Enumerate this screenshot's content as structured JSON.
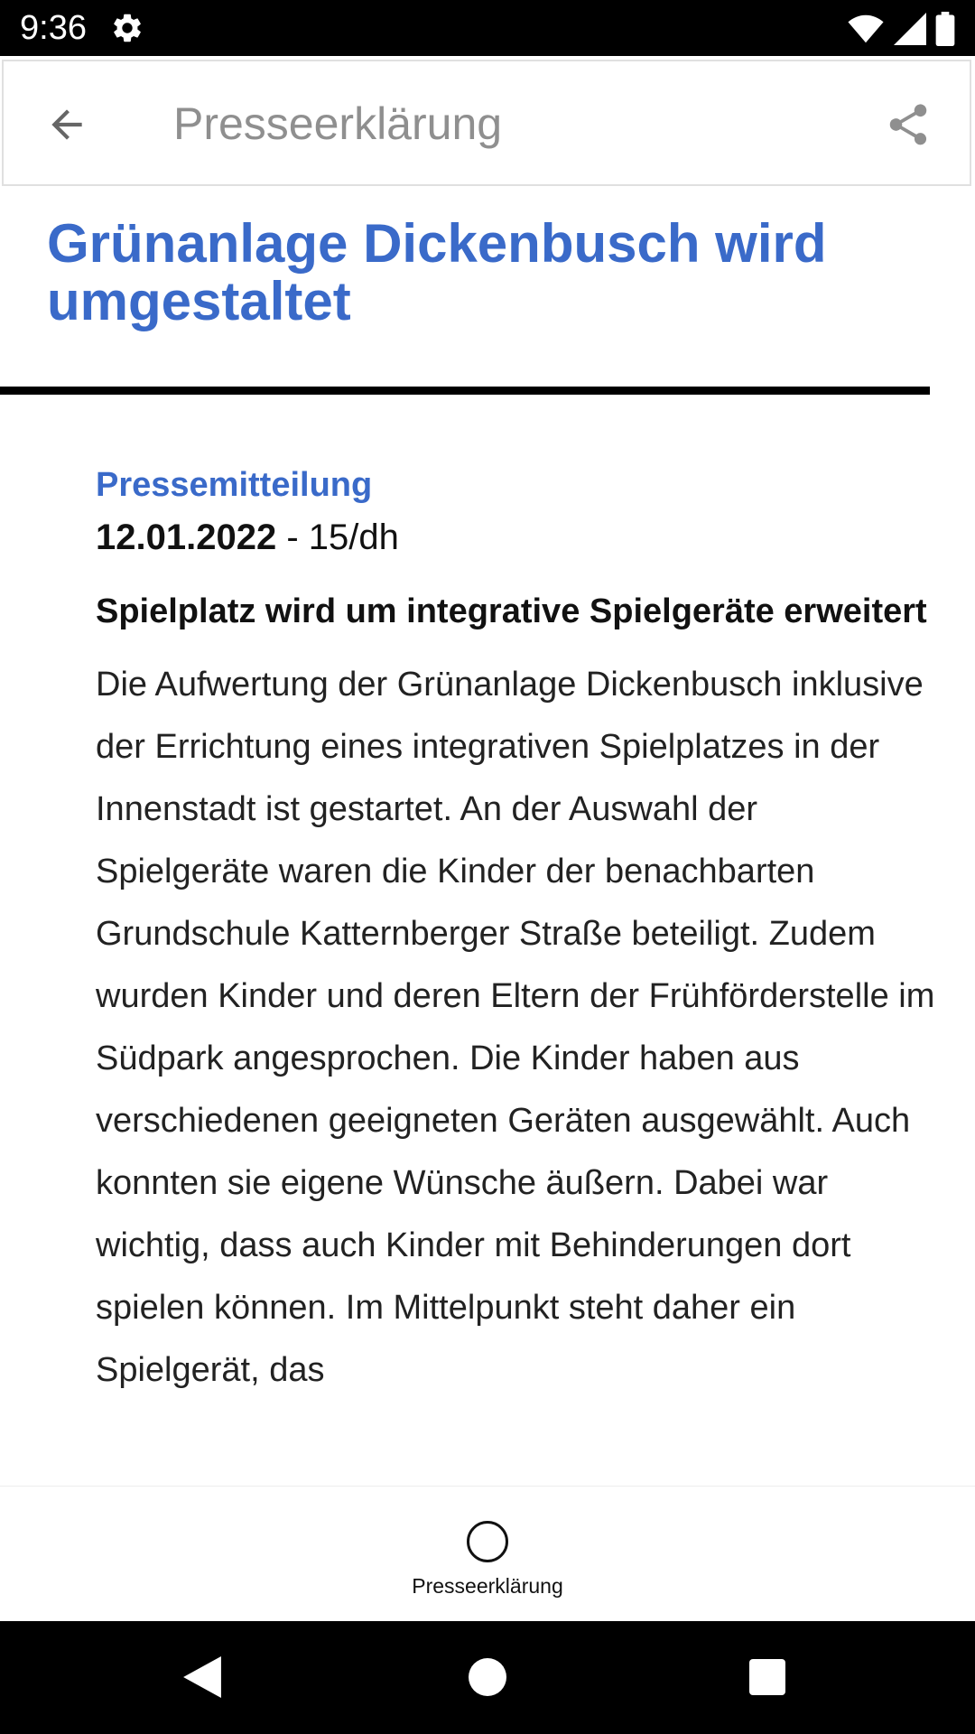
{
  "status_bar": {
    "time": "9:36",
    "icons": [
      "settings-gear-icon",
      "wifi-icon",
      "cellular-signal-icon",
      "battery-icon"
    ]
  },
  "app_bar": {
    "title": "Presseerklärung",
    "back_icon": "arrow-back-icon",
    "share_icon": "share-icon"
  },
  "article": {
    "headline": "Grünanlage Dickenbusch wird umgestaltet",
    "category": "Pressemitteilung",
    "date": "12.01.2022",
    "reference": " - 15/dh",
    "subheading": "Spielplatz wird um integrative Spielgeräte erweitert",
    "paragraph": "Die Aufwertung der Grünanlage Dickenbusch inklusive der Errichtung eines integrativen Spielplatzes in der Innenstadt ist gestartet. An der Auswahl der Spielgeräte waren die Kinder der benachbarten Grundschule Katternberger Straße beteiligt. Zudem wurden Kinder und deren Eltern der Frühförderstelle im Südpark angesprochen. Die Kinder haben aus verschiedenen geeigneten Geräten ausgewählt. Auch konnten sie eigene Wünsche äußern. Dabei war wichtig, dass auch Kinder mit Behinderungen dort spielen können. Im Mittelpunkt steht daher ein Spielgerät, das"
  },
  "bottom_nav": {
    "items": [
      {
        "label": "Presseerklärung",
        "icon": "circle-icon",
        "selected": true
      }
    ]
  },
  "system_nav": {
    "icons": [
      "back-triangle-icon",
      "home-circle-icon",
      "recents-square-icon"
    ]
  },
  "colors": {
    "accent": "#3a6ac9",
    "app_bar_title": "#8f8f8f",
    "status_bar": "#000000",
    "divider": "#000000"
  }
}
